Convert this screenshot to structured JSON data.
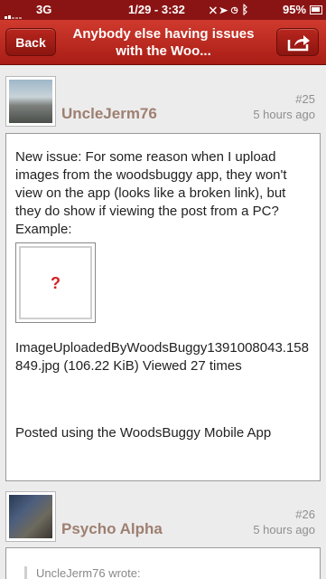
{
  "status_bar": {
    "carrier": "3G",
    "time": "1/29 - 3:32",
    "battery": "95%"
  },
  "nav": {
    "back_label": "Back",
    "title": "Anybody else having issues with the Woo...",
    "share_icon": "share-icon"
  },
  "posts": [
    {
      "number": "#25",
      "author": "UncleJerm76",
      "time": "5 hours ago",
      "body": "New issue: For some reason when I upload images from the woodsbuggy app, they won't view on the app (looks like a broken link), but they do show if viewing the post from a PC?",
      "example_label": "Example:",
      "broken_image_glyph": "?",
      "attachment": "ImageUploadedByWoodsBuggy1391008043.158849.jpg  (106.22 KiB) Viewed 27 times",
      "signature": "Posted using the WoodsBuggy Mobile App"
    },
    {
      "number": "#26",
      "author": "Psycho Alpha",
      "time": "5 hours ago",
      "quote_header": "UncleJerm76 wrote:"
    }
  ]
}
